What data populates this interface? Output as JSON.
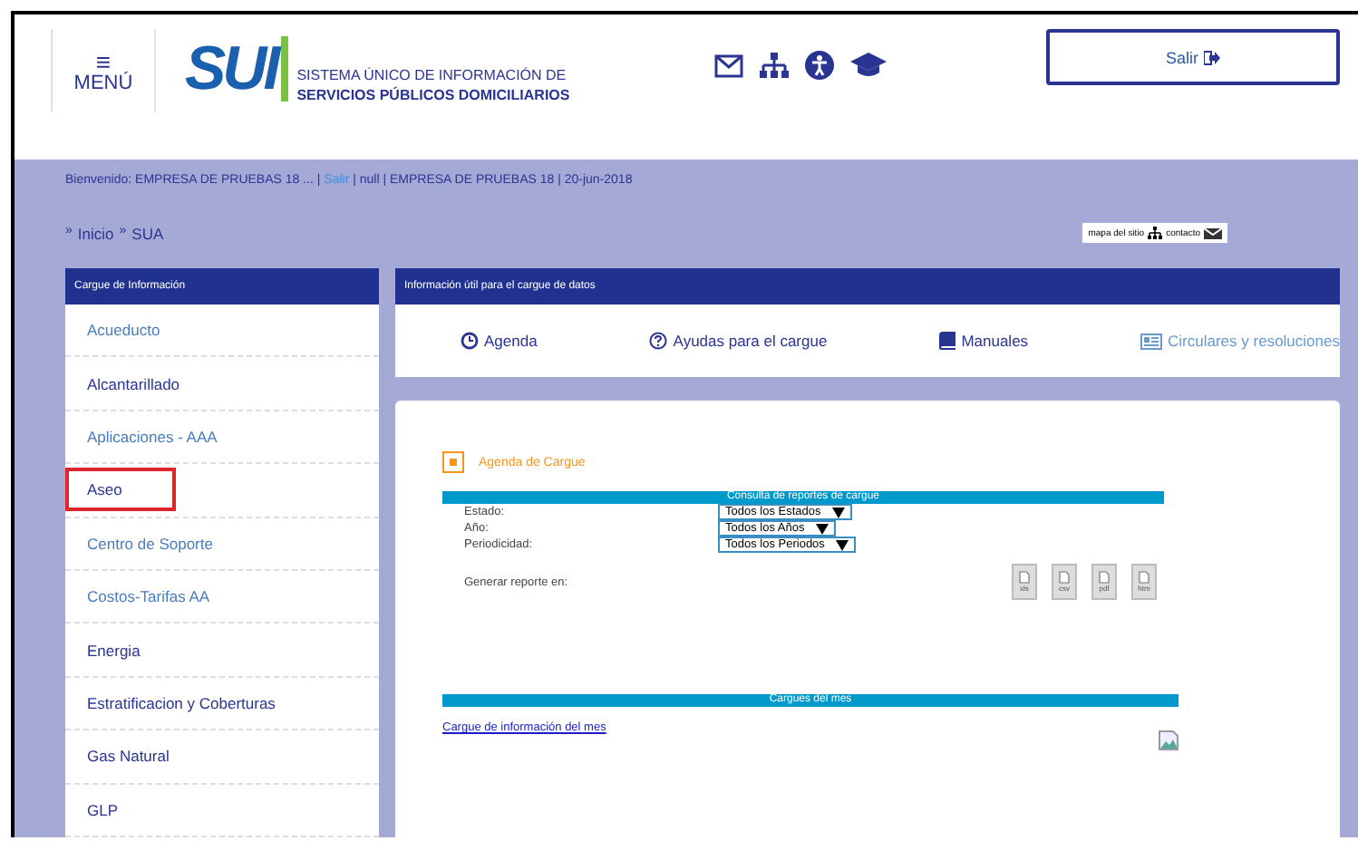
{
  "header": {
    "menu_icon": "≡",
    "menu_label": "MENÚ",
    "logo": "SUI",
    "title_line1": "SISTEMA ÚNICO DE INFORMACIÓN DE",
    "title_line2": "SERVICIOS PÚBLICOS DOMICILIARIOS",
    "logout_button": "Salir"
  },
  "welcome": {
    "prefix": "Bienvenido: EMPRESA DE PRUEBAS 18 ... |",
    "link": "Salir",
    "rest": "| null | EMPRESA DE PRUEBAS 18 | 20-jun-2018"
  },
  "breadcrumb": [
    {
      "separator": "»",
      "label": "Inicio"
    },
    {
      "separator": "»",
      "label": "SUA"
    }
  ],
  "utility_links": [
    "mapa del sitio",
    "contacto"
  ],
  "sidebar": {
    "title": "Cargue de Información",
    "items": [
      {
        "label": "Acueducto",
        "visited": false,
        "highlighted": false
      },
      {
        "label": "Alcantarillado",
        "visited": true,
        "highlighted": false
      },
      {
        "label": "Aplicaciones - AAA",
        "visited": false,
        "highlighted": false
      },
      {
        "label": "Aseo",
        "visited": true,
        "highlighted": true
      },
      {
        "label": "Centro de Soporte",
        "visited": false,
        "highlighted": false
      },
      {
        "label": "Costos-Tarifas AA",
        "visited": false,
        "highlighted": false
      },
      {
        "label": "Energia",
        "visited": true,
        "highlighted": false
      },
      {
        "label": "Estratificacion y Coberturas",
        "visited": true,
        "highlighted": false
      },
      {
        "label": "Gas Natural",
        "visited": true,
        "highlighted": false
      },
      {
        "label": "GLP",
        "visited": true,
        "highlighted": false
      }
    ]
  },
  "info_panel": {
    "title": "Información útil para el cargue de datos",
    "links": [
      {
        "kind": "clock",
        "label": "Agenda",
        "visited": true
      },
      {
        "kind": "help",
        "label": "Ayudas para el cargue",
        "visited": true
      },
      {
        "kind": "book",
        "label": "Manuales",
        "visited": true
      },
      {
        "kind": "newspaper",
        "label": "Circulares y resoluciones",
        "visited": false
      }
    ]
  },
  "agenda": {
    "title": "Agenda de Cargue",
    "query_title": "Consulta de reportes de cargue",
    "filters": [
      {
        "label": "Estado:",
        "value": "Todos los Estados"
      },
      {
        "label": "Año:",
        "value": "Todos los Años"
      },
      {
        "label": "Periodicidad:",
        "value": "Todos los Periodos"
      }
    ],
    "report_label": "Generar reporte en:",
    "formats": [
      "xls",
      "csv",
      "pdf",
      "htm"
    ],
    "month_title": "Cargues del mes",
    "month_link": "Cargue de información del mes"
  }
}
